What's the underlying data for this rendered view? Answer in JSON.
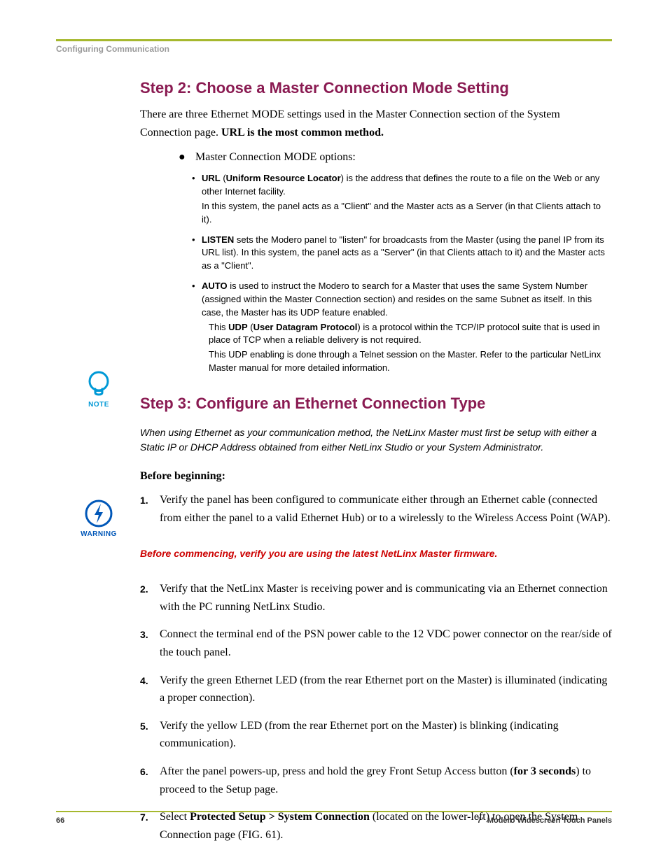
{
  "header": {
    "breadcrumb": "Configuring Communication"
  },
  "step2": {
    "heading": "Step 2: Choose a Master Connection Mode Setting",
    "intro_pre": "There are three Ethernet MODE settings used in the Master Connection section of the System Connection page. ",
    "intro_bold": "URL is the most common method.",
    "options_label_pre": "Master Connection MODE",
    "options_label_post": " options:",
    "items": {
      "url": {
        "label": "URL",
        "paren": " (",
        "expansion": "Uniform Resource Locator",
        "paren_close": ") ",
        "desc": "is the address that defines the route to a file on the Web or any other Internet facility.",
        "cont": "In this system, the panel acts as a \"Client\" and the Master acts as a Server (in that Clients attach to it)."
      },
      "listen": {
        "label": "LISTEN",
        "desc": " sets the Modero panel to \"listen\" for broadcasts from the Master (using the panel IP from its URL list). In this system, the panel acts as a \"Server\" (in that Clients attach to it) and the Master acts as a \"Client\"."
      },
      "auto": {
        "label": "AUTO",
        "desc": " is used to instruct the Modero to search for a Master that uses the same System Number (assigned within the Master Connection section) and resides on the same Subnet as itself. In this case, the Master has its UDP feature enabled.",
        "udp_pre": "This ",
        "udp_bold": "UDP",
        "udp_paren": " (",
        "udp_exp": "User Datagram Protocol",
        "udp_paren_close": ") ",
        "udp_desc": "is a protocol within the TCP/IP protocol suite that is used in place of TCP when a reliable delivery is not required.",
        "udp_cont": "This UDP enabling is done through a Telnet session on the Master. Refer to the particular NetLinx Master manual for more detailed information."
      }
    }
  },
  "step3": {
    "heading": "Step 3: Configure an Ethernet Connection Type",
    "note_label": "NOTE",
    "note_text": "When using Ethernet as your communication method, the NetLinx Master must first be setup with either a Static IP or DHCP Address obtained from either NetLinx Studio or your System Administrator.",
    "before": "Before beginning:",
    "step1": "Verify the panel has been configured to communicate either through an Ethernet cable (connected from either the panel to a valid Ethernet Hub) or to a wirelessly to the Wireless Access Point (WAP).",
    "warn_label": "WARNING",
    "warn_text": "Before commencing, verify you are using the latest NetLinx Master firmware.",
    "step2": "Verify that the NetLinx Master is receiving power and is communicating via an Ethernet connection with the PC running NetLinx Studio.",
    "step3": "Connect the terminal end of the PSN power cable to the 12 VDC power connector on the rear/side of the touch panel.",
    "step4": "Verify the green Ethernet LED (from the rear Ethernet port on the Master) is illuminated (indicating a proper connection).",
    "step5": "Verify the yellow LED (from the rear Ethernet port on the Master) is blinking (indicating communication).",
    "step6_pre": "After the panel powers-up, press and hold the grey Front Setup Access button (",
    "step6_bold": "for 3 seconds",
    "step6_post": ") to proceed to the Setup page.",
    "step7_pre": "Select ",
    "step7_bold": "Protected Setup > System Connection",
    "step7_post": " (located on the lower-left) to open the System Connection page (FIG. 61)."
  },
  "footer": {
    "page": "66",
    "title": "7\" Modero Widescreen Touch Panels"
  }
}
